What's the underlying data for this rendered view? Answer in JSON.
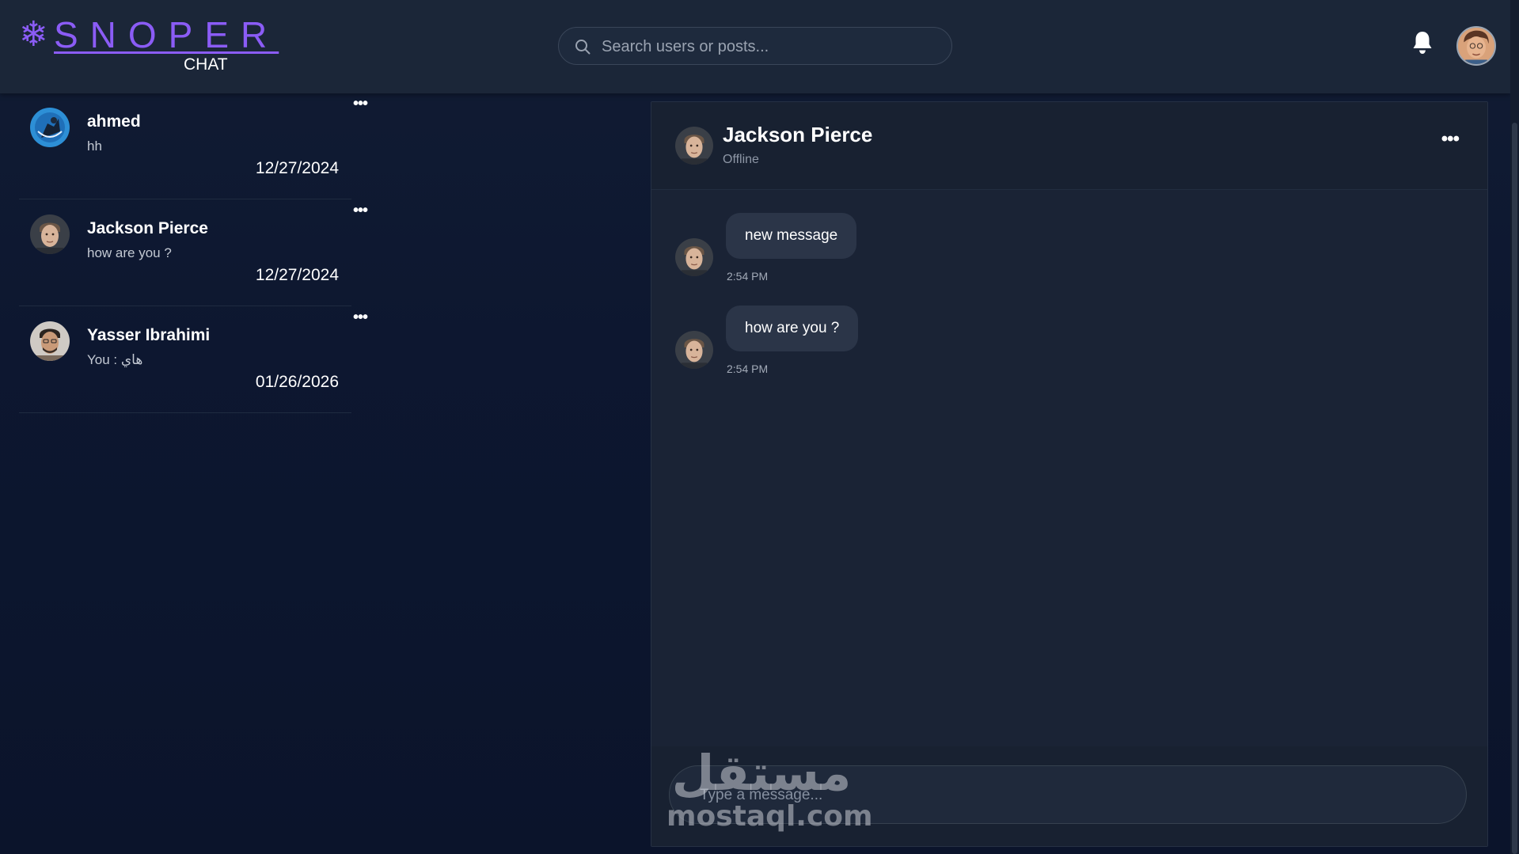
{
  "brand": {
    "logo_symbol": "❄",
    "name": "SNOPER",
    "subtitle": "CHAT",
    "accent_color": "#8b5cf6"
  },
  "header": {
    "search_placeholder": "Search users or posts...",
    "icons": [
      "search-icon",
      "bell-icon",
      "user-avatar"
    ]
  },
  "conversations": [
    {
      "name": "ahmed",
      "preview": "hh",
      "date": "12/27/2024",
      "more": "•••"
    },
    {
      "name": "Jackson Pierce",
      "preview": "how are you ?",
      "date": "12/27/2024",
      "more": "•••"
    },
    {
      "name": "Yasser Ibrahimi",
      "preview": "You : هاي",
      "date": "01/26/2026",
      "more": "•••"
    }
  ],
  "chat": {
    "contact_name": "Jackson Pierce",
    "status": "Offline",
    "more": "•••",
    "messages": [
      {
        "text": "new message",
        "time": "2:54 PM"
      },
      {
        "text": "how are you ?",
        "time": "2:54 PM"
      }
    ],
    "composer_placeholder": "Type a message..."
  },
  "watermark": {
    "arabic": "مستقل",
    "latin": "mostaql.com"
  }
}
